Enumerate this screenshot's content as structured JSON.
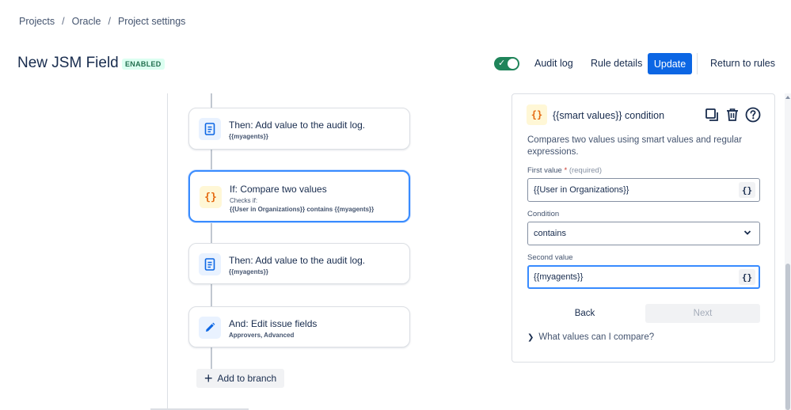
{
  "breadcrumb": {
    "items": [
      "Projects",
      "Oracle",
      "Project settings"
    ],
    "separator": "/"
  },
  "header": {
    "title": "New JSM Field",
    "status_badge": "ENABLED",
    "toggle_enabled": true,
    "audit_log": "Audit log",
    "rule_details": "Rule details",
    "update": "Update",
    "return_to_rules": "Return to rules"
  },
  "canvas": {
    "cards": [
      {
        "title": "Then: Add value to the audit log.",
        "detail": "{{myagents}}",
        "icon": "document-icon"
      },
      {
        "title": "If: Compare two values",
        "checks_label": "Checks if:",
        "detail": "{{User in Organizations}} contains {{myagents}}",
        "icon": "smart-value-icon",
        "icon_text": "{}",
        "selected": true
      },
      {
        "title": "Then: Add value to the audit log.",
        "detail": "{{myagents}}",
        "icon": "document-icon"
      },
      {
        "title": "And: Edit issue fields",
        "detail": "Approvers, Advanced",
        "icon": "pencil-icon"
      }
    ],
    "add_to_branch": "Add to branch"
  },
  "panel": {
    "icon_text": "{}",
    "title": "{{smart values}} condition",
    "description": "Compares two values using smart values and regular expressions.",
    "first_value_label": "First value",
    "required_marker": "*",
    "required_hint": "(required)",
    "first_value": "{{User in Organizations}}",
    "condition_label": "Condition",
    "condition_value": "contains",
    "second_value_label": "Second value",
    "second_value": "{{myagents}}",
    "smart_value_button": "{}",
    "back": "Back",
    "next": "Next",
    "expander": "What values can I compare?"
  },
  "colors": {
    "primary": "#0c66e4",
    "enabled_green": "#1f845a",
    "focus_blue": "#388bff",
    "smart_value_orange": "#e56910"
  }
}
